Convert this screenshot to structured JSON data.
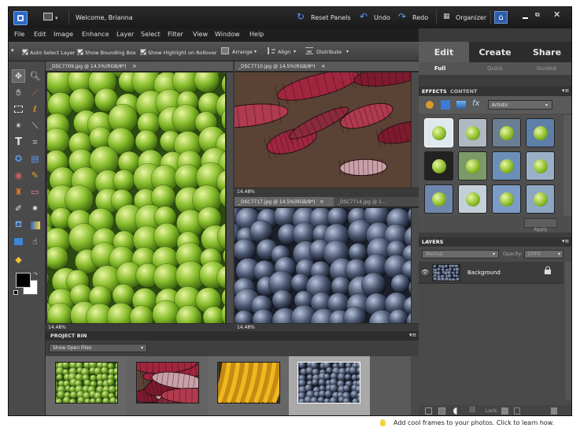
{
  "titlebar": {
    "welcome": "Welcome, Brianna",
    "reset_panels": "Reset Panels",
    "undo": "Undo",
    "redo": "Redo",
    "organizer": "Organizer"
  },
  "menu": [
    "File",
    "Edit",
    "Image",
    "Enhance",
    "Layer",
    "Select",
    "Filter",
    "View",
    "Window",
    "Help"
  ],
  "options": {
    "auto_select": "Auto Select Layer",
    "bounding_box": "Show Bounding Box",
    "highlight": "Show Highlight on Rollover",
    "arrange": "Arrange",
    "align": "Align",
    "distribute": "Distribute"
  },
  "documents": {
    "doc1": {
      "tab": "_DSC7709.jpg @ 14.5%(RGB/8*)",
      "zoom": "14.48%"
    },
    "doc2": {
      "tab": "_DSC7710.jpg @ 14.5%(RGB/8*)",
      "zoom": "14.48%"
    },
    "doc3": {
      "tab": "_DSC7717.jpg @ 14.5%(RGB/8*)",
      "tab_inactive": "_DSC7714.jpg @ 1...",
      "zoom": "14.48%"
    }
  },
  "panel_tabs": {
    "edit": "Edit",
    "create": "Create",
    "share": "Share",
    "full": "Full",
    "quick": "Quick",
    "guided": "Guided"
  },
  "effects": {
    "tab_effects": "EFFECTS",
    "tab_content": "CONTENT",
    "category": "Artistic",
    "apply": "Apply"
  },
  "layers": {
    "title": "LAYERS",
    "blend_mode": "Normal",
    "opacity_label": "Opacity:",
    "opacity_value": "100%",
    "layer_name": "Background",
    "lock_label": "Lock:"
  },
  "project_bin": {
    "title": "PROJECT BIN",
    "dropdown": "Show Open Files"
  },
  "tip": "Add cool frames to your photos. Click to learn how.",
  "colors": {
    "accent_blue": "#3f7fd1",
    "limes": "#7fb52a",
    "corn": "#a0263e",
    "bananas": "#e2a21a",
    "berries": "#4a5670"
  }
}
